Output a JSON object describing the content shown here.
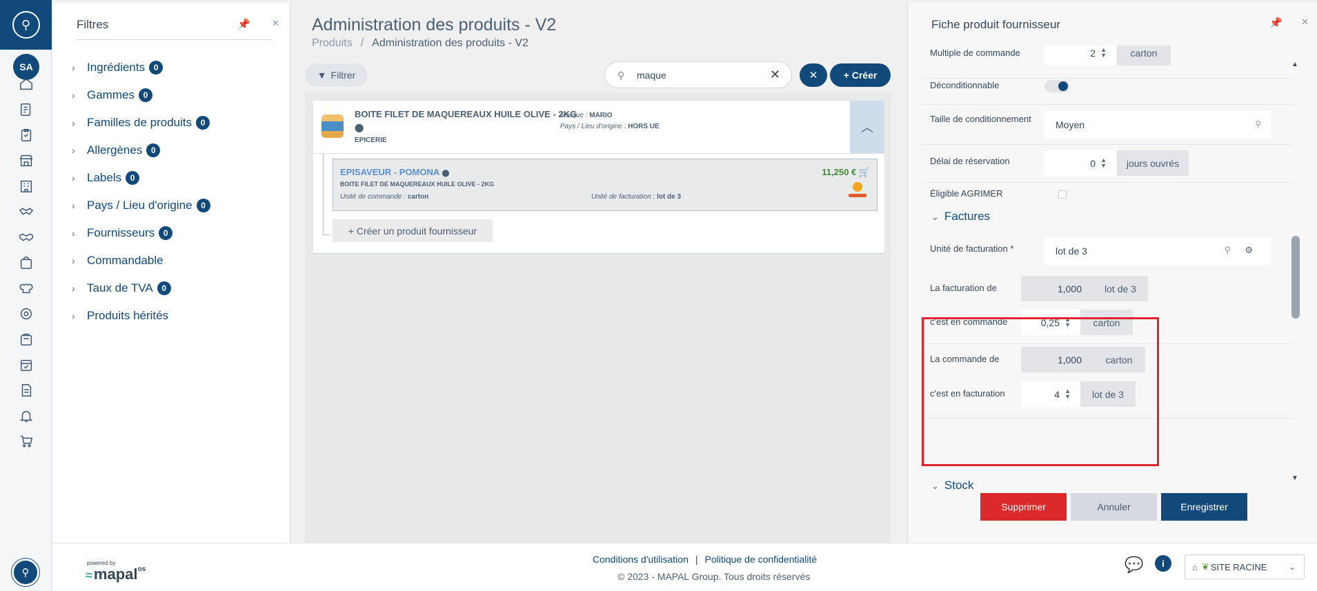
{
  "rail": {
    "avatar_initials": "SA",
    "icons": [
      "home-icon",
      "edit-icon",
      "clipboard-icon",
      "store-icon",
      "building-icon",
      "handshake-icon",
      "handshake-alt-icon",
      "bag-icon",
      "chef-hat-icon",
      "gear-icon",
      "basket-icon",
      "calendar-check-icon",
      "document-icon",
      "bell-icon",
      "cart-icon"
    ]
  },
  "filters": {
    "title": "Filtres",
    "items": [
      {
        "label": "Ingrédients",
        "count": "0"
      },
      {
        "label": "Gammes",
        "count": "0"
      },
      {
        "label": "Familles de produits",
        "count": "0"
      },
      {
        "label": "Allergènes",
        "count": "0"
      },
      {
        "label": "Labels",
        "count": "0"
      },
      {
        "label": "Pays / Lieu d'origine",
        "count": "0"
      },
      {
        "label": "Fournisseurs",
        "count": "0"
      },
      {
        "label": "Commandable",
        "count": null
      },
      {
        "label": "Taux de TVA",
        "count": "0"
      },
      {
        "label": "Produits hérités",
        "count": null
      }
    ]
  },
  "center": {
    "title": "Administration des produits - V2",
    "breadcrumb": {
      "root": "Produits",
      "sep": "/",
      "current": "Administration des produits - V2"
    },
    "filter_button": "Filtrer",
    "search_value": "maque",
    "create_button": "+ Créer",
    "product": {
      "name": "BOITE FILET DE MAQUEREAUX HUILE OLIVE - 2KG",
      "category": "EPICERIE",
      "brand_label": "Marque :",
      "brand_value": "MARIO",
      "origin_label": "Pays / Lieu d'origine :",
      "origin_value": "HORS UE"
    },
    "supplier_product": {
      "supplier": "EPISAVEUR - POMONA",
      "product": "BOITE FILET DE MAQUEREAUX HUILE OLIVE - 2KG",
      "order_unit_label": "Unité de commande :",
      "order_unit_value": "carton",
      "billing_unit_label": "Unité de facturation :",
      "billing_unit_value": "lot de 3",
      "price": "11,250 €"
    },
    "add_supplier_product": "+ Créer un produit fournisseur"
  },
  "right": {
    "title": "Fiche produit fournisseur",
    "order_multiple": {
      "label": "Multiple de commande",
      "value": "2",
      "unit": "carton"
    },
    "unpackable": {
      "label": "Déconditionnable"
    },
    "pack_size": {
      "label": "Taille de conditionnement",
      "value": "Moyen"
    },
    "reservation_delay": {
      "label": "Délai de réservation",
      "value": "0",
      "unit": "jours ouvrés"
    },
    "agrimer": {
      "label": "Éligible AGRIMER"
    },
    "invoices_section": "Factures",
    "billing_unit": {
      "label": "Unité de facturation *",
      "value": "lot de 3"
    },
    "billing_of": {
      "label": "La facturation de",
      "value": "1,000",
      "unit": "lot de 3"
    },
    "is_in_order": {
      "label": "c'est en commande",
      "value": "0,25",
      "unit": "carton"
    },
    "order_of": {
      "label": "La commande de",
      "value": "1,000",
      "unit": "carton"
    },
    "is_in_billing": {
      "label": "c'est en facturation",
      "value": "4",
      "unit": "lot de 3"
    },
    "stock_section": "Stock",
    "delete_button": "Supprimer",
    "cancel_button": "Annuler",
    "save_button": "Enregistrer"
  },
  "footer": {
    "powered_by": "powered by",
    "brand": "mapal",
    "brand_suffix": "os",
    "terms": "Conditions d'utilisation",
    "separator": "|",
    "privacy": "Politique de confidentialité",
    "copyright": "© 2023 - MAPAL Group. Tous droits réservés",
    "site": "SITE RACINE"
  }
}
